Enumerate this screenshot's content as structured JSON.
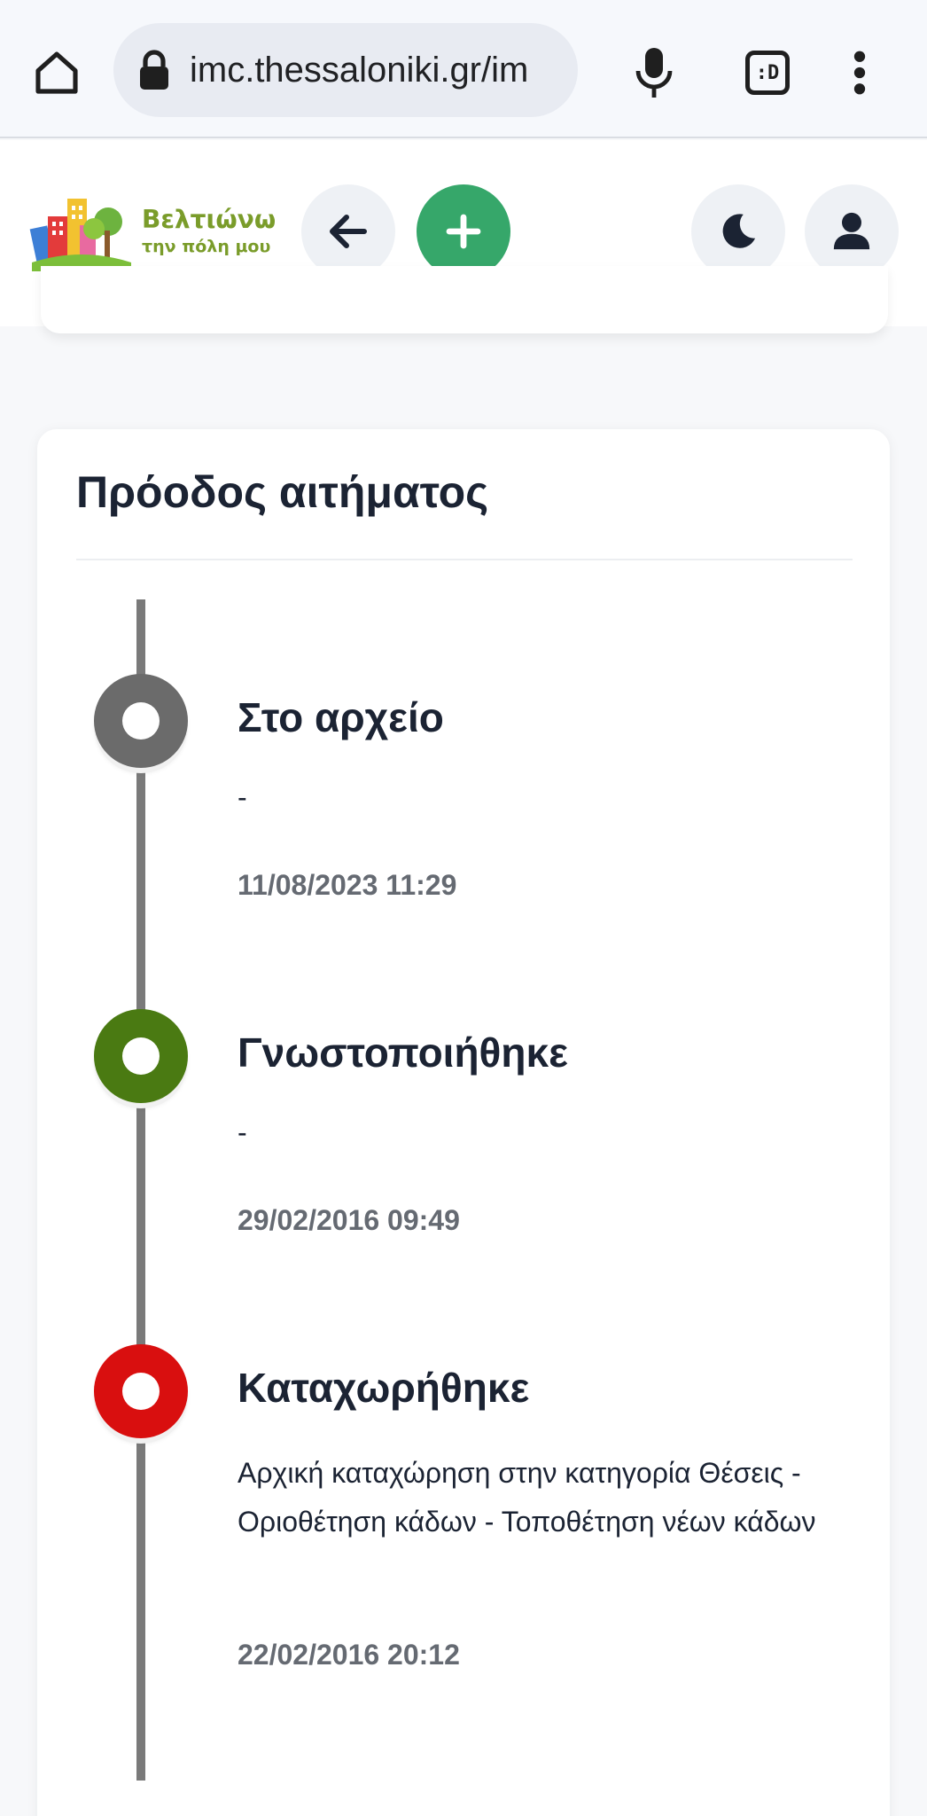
{
  "browser": {
    "url": "imc.thessaloniki.gr/im",
    "icons": [
      "home-icon",
      "lock-icon",
      "microphone-icon",
      "tab-switcher-icon",
      "more-vert-icon"
    ],
    "tab_label": ":D"
  },
  "header": {
    "logo": {
      "title": "Βελτιώνω",
      "subtitle": "την πόλη μου"
    },
    "buttons": [
      "back-arrow-icon",
      "plus-icon",
      "moon-icon",
      "user-icon"
    ],
    "colors": {
      "add_button": "#36a76a"
    }
  },
  "progress": {
    "title": "Πρόοδος αιτήματος",
    "steps": [
      {
        "title": "Στο αρχείο",
        "description": "-",
        "date": "11/08/2023 11:29",
        "color": "#6b6b6b"
      },
      {
        "title": "Γνωστοποιήθηκε",
        "description": "-",
        "date": "29/02/2016 09:49",
        "color": "#4a7a12"
      },
      {
        "title": "Καταχωρήθηκε",
        "description": "Αρχική καταχώρηση στην κατηγορία Θέσεις - Οριοθέτηση κάδων - Τοποθέτηση νέων κάδων",
        "date": "22/02/2016 20:12",
        "color": "#d90f0f"
      }
    ]
  }
}
